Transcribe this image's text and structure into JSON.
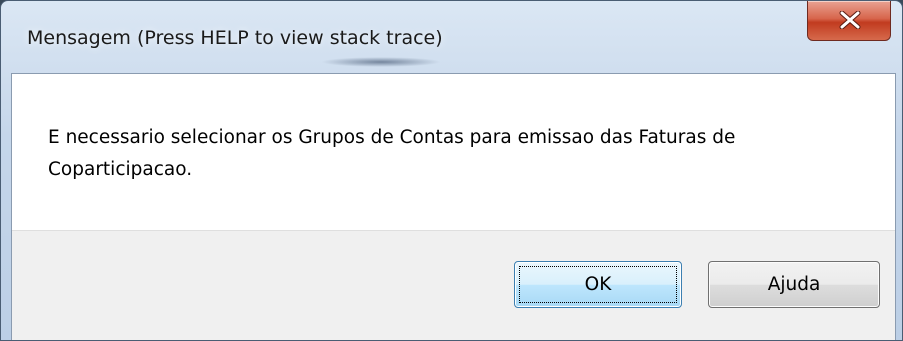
{
  "window": {
    "title": "Mensagem (Press HELP to view stack trace)",
    "close_icon": "close-icon"
  },
  "dialog": {
    "message": "E necessario selecionar os Grupos de Contas para emissao das Faturas de Coparticipacao."
  },
  "buttons": {
    "ok_label": "OK",
    "help_label": "Ajuda"
  },
  "colors": {
    "close_button": "#c94a2e",
    "ok_border": "#3c7fb1",
    "footer_background": "#f0f0f0"
  }
}
